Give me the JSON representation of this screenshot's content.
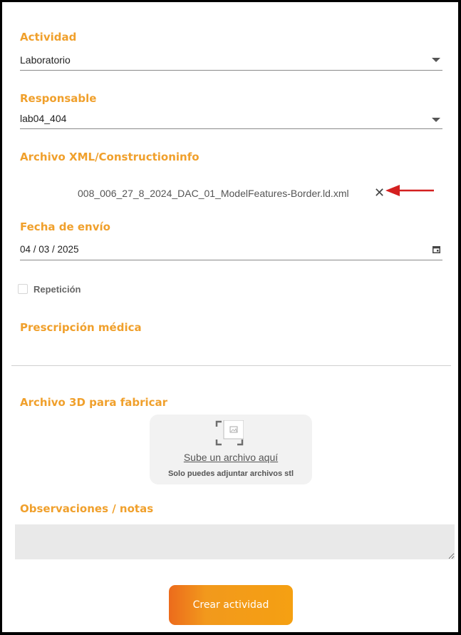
{
  "form": {
    "activity": {
      "label": "Actividad",
      "value": "Laboratorio"
    },
    "responsible": {
      "label": "Responsable",
      "value": "lab04_404"
    },
    "xml_file": {
      "label": "Archivo XML/Constructioninfo",
      "file_name": "008_006_27_8_2024_DAC_01_ModelFeatures-Border.ld.xml"
    },
    "send_date": {
      "label": "Fecha de envío",
      "value": "04 / 03 / 2025"
    },
    "repetition": {
      "label": "Repetición",
      "checked": false
    },
    "prescription": {
      "label": "Prescripción médica"
    },
    "file_3d": {
      "label": "Archivo 3D para fabricar",
      "upload_link": "Sube un archivo aquí",
      "hint": "Solo puedes adjuntar archivos stl"
    },
    "notes": {
      "label": "Observaciones / notas",
      "value": ""
    },
    "submit_label": "Crear actividad"
  },
  "icons": {
    "caret": "chevron-down-icon",
    "clear": "close-icon",
    "calendar": "calendar-icon",
    "upload": "image-upload-icon",
    "annotation": "red-arrow-icon"
  },
  "colors": {
    "label": "#f0a02c",
    "button_start": "#ec6b1c",
    "button_end": "#f5a012",
    "annotation_arrow": "#d42020"
  }
}
